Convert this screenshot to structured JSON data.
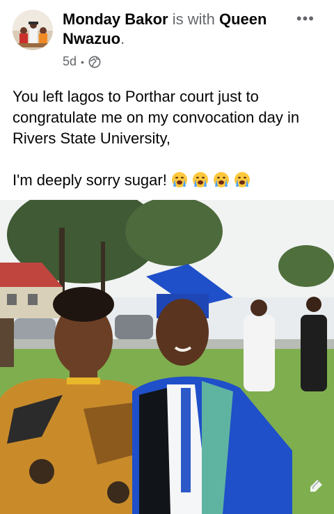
{
  "post": {
    "author": "Monday Bakor",
    "with_word": "is with",
    "tagged": "Queen Nwazuo",
    "period": ".",
    "time": "5d",
    "separator": "•",
    "privacy_icon": "globe-icon",
    "more_label": "•••",
    "caption_line1": "You left lagos to Porthar court just to congratulate me on my convocation day in Rivers State University,",
    "caption_line2": "I'm deeply sorry sugar!",
    "emoji_count": 4,
    "emoji_name": "loudly-crying-face"
  },
  "photo": {
    "alt_icon": "edit-arrow-icon"
  },
  "colors": {
    "text": "#050505",
    "secondary": "#65676b",
    "gown_blue": "#1f4fc9"
  }
}
